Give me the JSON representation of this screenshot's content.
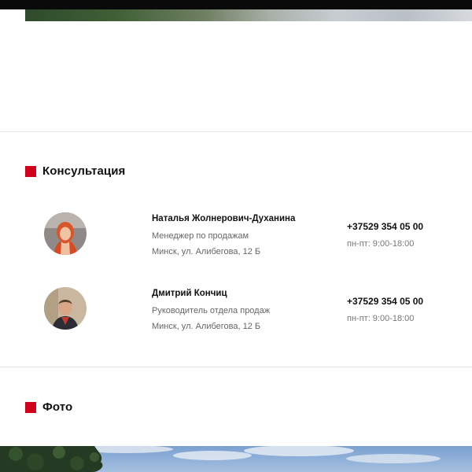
{
  "sections": {
    "consultation": {
      "title": "Консультация"
    },
    "photo": {
      "title": "Фото"
    }
  },
  "contacts": [
    {
      "name": "Наталья Жолнерович-Духанина",
      "role": "Менеджер по продажам",
      "address": "Минск, ул. Алибегова, 12 Б",
      "phone": "+37529 354 05 00",
      "hours": "пн-пт: 9:00-18:00"
    },
    {
      "name": "Дмитрий Кончиц",
      "role": "Руководитель отдела продаж",
      "address": "Минск, ул. Алибегова, 12 Б",
      "phone": "+37529 354 05 00",
      "hours": "пн-пт: 9:00-18:00"
    }
  ],
  "colors": {
    "accent": "#d0021b",
    "text": "#111111",
    "muted": "#666666",
    "divider": "#e5e5e5"
  }
}
